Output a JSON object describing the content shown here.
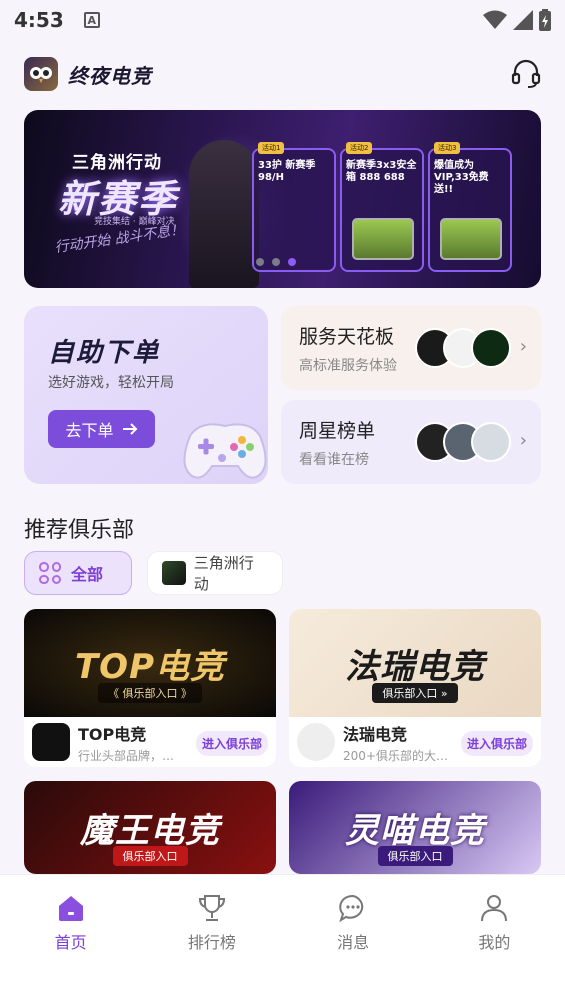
{
  "status_bar": {
    "time": "4:53",
    "a_icon": "A"
  },
  "header": {
    "logo_icon": "owl-logo-icon",
    "title": "终夜电竞",
    "support_icon": "headset-icon"
  },
  "banner": {
    "title1": "三角洲行动",
    "title2": "新赛季",
    "sub": "竞技集结 · 巅峰对决",
    "script": "行动开始 战斗不息！",
    "panels": [
      {
        "tag": "活动1",
        "text": "33护 新赛季 98/H",
        "tag2": ""
      },
      {
        "tag": "活动2",
        "text": "新赛季3x3安全箱 888 688",
        "tag2": ""
      },
      {
        "tag": "活动3",
        "text": "爆值成为VIP,33免费送!!",
        "tag2": ""
      }
    ],
    "active_dot": 2
  },
  "quick_order": {
    "title": "自助下单",
    "subtitle": "选好游戏，轻松开局",
    "button": "去下单",
    "button_icon": "arrow-right-icon"
  },
  "service_card": {
    "title": "服务天花板",
    "subtitle": "高标准服务体验"
  },
  "weekly_card": {
    "title": "周星榜单",
    "subtitle": "看看谁在榜"
  },
  "section": {
    "title": "推荐俱乐部"
  },
  "filters": {
    "all": "全部",
    "game": "三角洲行动"
  },
  "clubs": [
    {
      "banner_text": "TOP电竞",
      "banner_sub": "《 俱乐部入口 》",
      "name": "TOP电竞",
      "desc": "行业头部品牌，…",
      "join": "进入俱乐部"
    },
    {
      "banner_text": "法瑞电竞",
      "banner_sub": "俱乐部入口 »",
      "name": "法瑞电竞",
      "desc": "200+俱乐部的大…",
      "join": "进入俱乐部"
    },
    {
      "banner_text": "魔王电竞",
      "banner_sub": "俱乐部入口",
      "name": "",
      "desc": "",
      "join": ""
    },
    {
      "banner_text": "灵喵电竞",
      "banner_sub": "俱乐部入口",
      "name": "",
      "desc": "",
      "join": ""
    }
  ],
  "bottom_nav": [
    {
      "label": "首页",
      "icon": "home-icon",
      "active": true
    },
    {
      "label": "排行榜",
      "icon": "trophy-icon",
      "active": false
    },
    {
      "label": "消息",
      "icon": "chat-icon",
      "active": false
    },
    {
      "label": "我的",
      "icon": "user-icon",
      "active": false
    }
  ],
  "colors": {
    "accent": "#7c4ddb",
    "background": "#f7f4fc"
  }
}
